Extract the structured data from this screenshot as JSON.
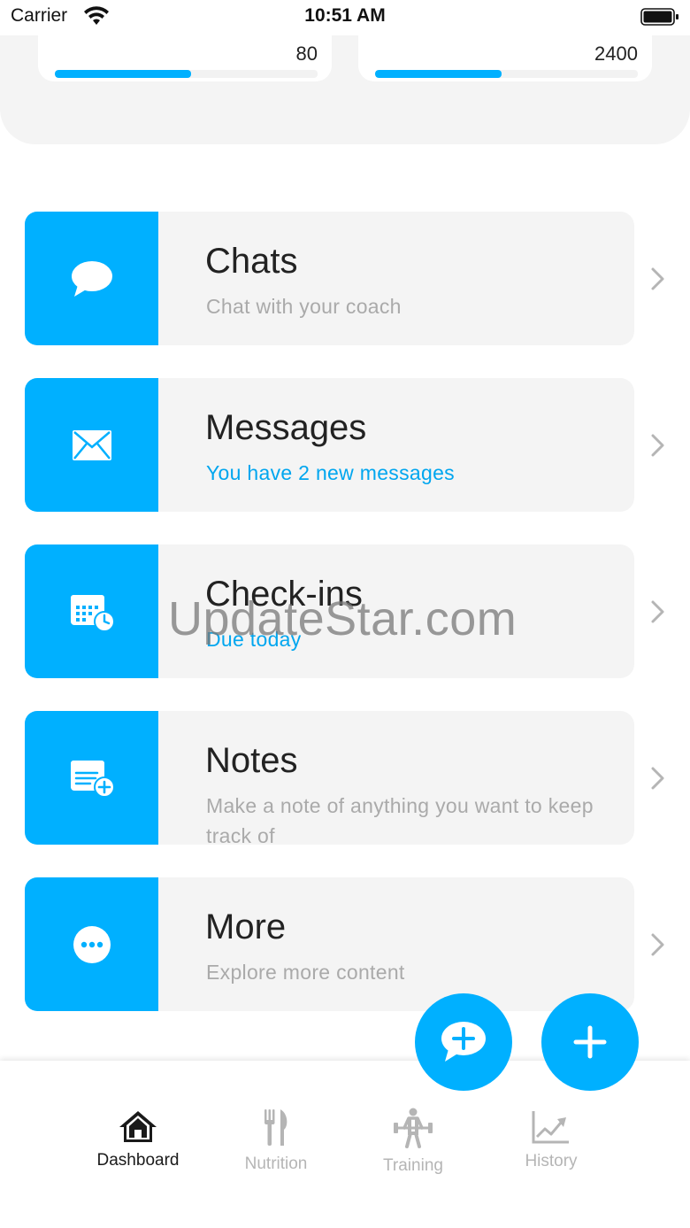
{
  "status_bar": {
    "carrier": "Carrier",
    "time": "10:51 AM"
  },
  "summary": {
    "left": {
      "value": "80",
      "progress": 0.52
    },
    "right": {
      "value": "2400",
      "progress": 0.48
    }
  },
  "menu": [
    {
      "title": "Chats",
      "subtitle": "Chat with your coach",
      "icon": "chat-bubble-icon"
    },
    {
      "title": "Messages",
      "subtitle": "You have 2 new messages",
      "icon": "envelope-icon"
    },
    {
      "title": "Check-ins",
      "subtitle": "Due today",
      "icon": "calendar-clock-icon"
    },
    {
      "title": "Notes",
      "subtitle": "Make a note of anything you want to keep track of",
      "icon": "note-add-icon"
    },
    {
      "title": "More",
      "subtitle": "Explore more content",
      "icon": "more-dots-icon"
    }
  ],
  "watermark": "UpdateStar.com",
  "tabs": [
    {
      "label": "Dashboard",
      "icon": "home-icon",
      "active": true
    },
    {
      "label": "Nutrition",
      "icon": "fork-knife-icon",
      "active": false
    },
    {
      "label": "Training",
      "icon": "weightlifter-icon",
      "active": false
    },
    {
      "label": "History",
      "icon": "chart-line-icon",
      "active": false
    }
  ],
  "colors": {
    "accent": "#00b0ff",
    "card_bg": "#f4f4f4",
    "muted_text": "#aaaaaa",
    "accent_text": "#00a6ef"
  }
}
